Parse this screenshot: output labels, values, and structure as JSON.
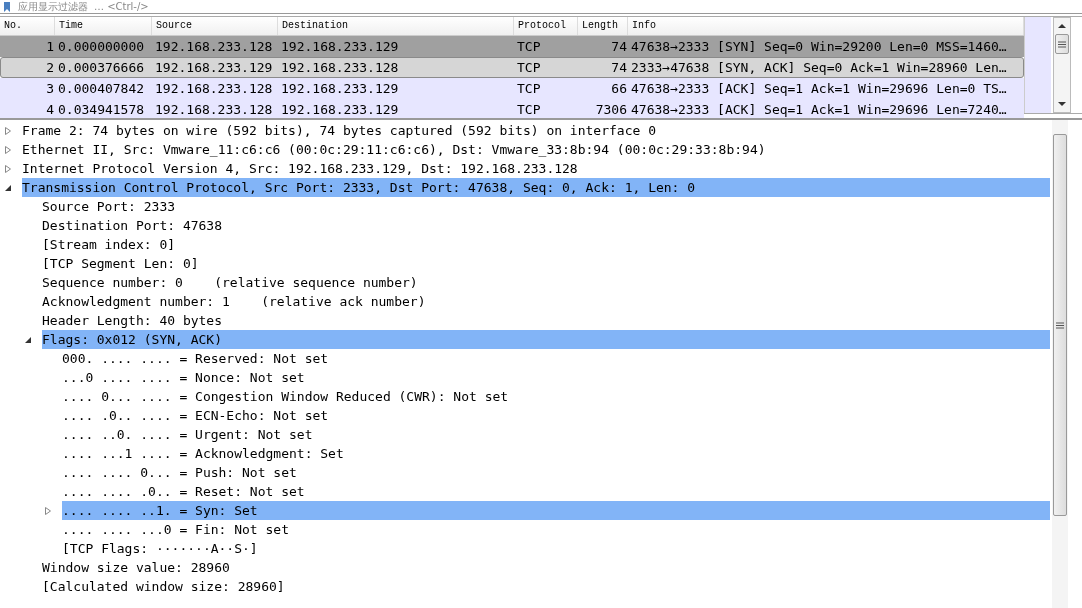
{
  "filter_bar": {
    "placeholder": "应用显示过滤器",
    "hint": "… <Ctrl-/>"
  },
  "packet_list": {
    "columns": [
      "No.",
      "Time",
      "Source",
      "Destination",
      "Protocol",
      "Length",
      "Info"
    ],
    "rows": [
      {
        "cells": [
          "1",
          "0.000000000",
          "192.168.233.128",
          "192.168.233.129",
          "TCP",
          "74",
          "47638→2333 [SYN] Seq=0 Win=29200 Len=0 MSS=1460…"
        ],
        "selected": false,
        "color": "#a0a0a0"
      },
      {
        "cells": [
          "2",
          "0.000376666",
          "192.168.233.129",
          "192.168.233.128",
          "TCP",
          "74",
          "2333→47638 [SYN, ACK] Seq=0 Ack=1 Win=28960 Len…"
        ],
        "selected": true,
        "color": "#d6d6d6"
      },
      {
        "cells": [
          "3",
          "0.000407842",
          "192.168.233.128",
          "192.168.233.129",
          "TCP",
          "66",
          "47638→2333 [ACK] Seq=1 Ack=1 Win=29696 Len=0 TS…"
        ],
        "selected": false,
        "color": "#e7e6ff"
      },
      {
        "cells": [
          "4",
          "0.034941578",
          "192.168.233.128",
          "192.168.233.129",
          "TCP",
          "7306",
          "47638→2333 [ACK] Seq=1 Ack=1 Win=29696 Len=7240…"
        ],
        "selected": false,
        "color": "#e7e6ff"
      }
    ]
  },
  "details": [
    {
      "label": "Frame 2: 74 bytes on wire (592 bits), 74 bytes captured (592 bits) on interface 0",
      "expanded": false,
      "selected": false
    },
    {
      "label": "Ethernet II, Src: Vmware_11:c6:c6 (00:0c:29:11:c6:c6), Dst: Vmware_33:8b:94 (00:0c:29:33:8b:94)",
      "expanded": false,
      "selected": false
    },
    {
      "label": "Internet Protocol Version 4, Src: 192.168.233.129, Dst: 192.168.233.128",
      "expanded": false,
      "selected": false
    },
    {
      "label": "Transmission Control Protocol, Src Port: 2333, Dst Port: 47638, Seq: 0, Ack: 1, Len: 0",
      "expanded": true,
      "selected": true,
      "children": [
        {
          "label": "Source Port: 2333",
          "selected": false
        },
        {
          "label": "Destination Port: 47638",
          "selected": false
        },
        {
          "label": "[Stream index: 0]",
          "selected": false
        },
        {
          "label": "[TCP Segment Len: 0]",
          "selected": false
        },
        {
          "label": "Sequence number: 0    (relative sequence number)",
          "selected": false
        },
        {
          "label": "Acknowledgment number: 1    (relative ack number)",
          "selected": false
        },
        {
          "label": "Header Length: 40 bytes",
          "selected": false
        },
        {
          "label": "Flags: 0x012 (SYN, ACK)",
          "expanded": true,
          "selected": true,
          "children": [
            {
              "label": "000. .... .... = Reserved: Not set",
              "selected": false
            },
            {
              "label": "...0 .... .... = Nonce: Not set",
              "selected": false
            },
            {
              "label": ".... 0... .... = Congestion Window Reduced (CWR): Not set",
              "selected": false
            },
            {
              "label": ".... .0.. .... = ECN-Echo: Not set",
              "selected": false
            },
            {
              "label": ".... ..0. .... = Urgent: Not set",
              "selected": false
            },
            {
              "label": ".... ...1 .... = Acknowledgment: Set",
              "selected": false
            },
            {
              "label": ".... .... 0... = Push: Not set",
              "selected": false
            },
            {
              "label": ".... .... .0.. = Reset: Not set",
              "selected": false
            },
            {
              "label": ".... .... ..1. = Syn: Set",
              "expanded": false,
              "selected": true
            },
            {
              "label": ".... .... ...0 = Fin: Not set",
              "selected": false
            },
            {
              "label": "[TCP Flags: ·······A··S·]",
              "selected": false
            }
          ]
        },
        {
          "label": "Window size value: 28960",
          "selected": false
        },
        {
          "label": "[Calculated window size: 28960]",
          "selected": false
        }
      ]
    }
  ]
}
